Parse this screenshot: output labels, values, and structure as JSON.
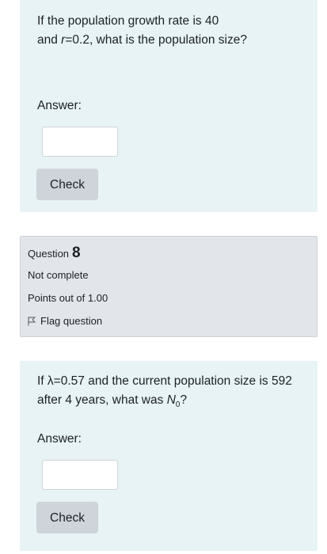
{
  "question7": {
    "text_a": "If the population growth rate is 40",
    "text_b_pre": "and ",
    "text_b_var": "r",
    "text_b_post": "=0.2, what is the population size?",
    "answer_label": "Answer:",
    "answer_value": "",
    "check_label": "Check"
  },
  "info": {
    "question_label": "Question",
    "question_number": "8",
    "state": "Not complete",
    "grade": "Points out of 1.00",
    "flag_label": "Flag question",
    "flag_icon": "flag-icon"
  },
  "question8": {
    "text_pre": "If ",
    "lambda": "λ",
    "text_mid": "=0.57 and the current population size is 592 after 4 years, what was ",
    "n_var": "N",
    "n_sub": "0",
    "text_end": "?",
    "answer_label": "Answer:",
    "answer_value": "",
    "check_label": "Check"
  },
  "colors": {
    "question_bg": "#e7f3f5",
    "info_bg": "#e2e5e9",
    "button_bg": "#ced4da"
  }
}
